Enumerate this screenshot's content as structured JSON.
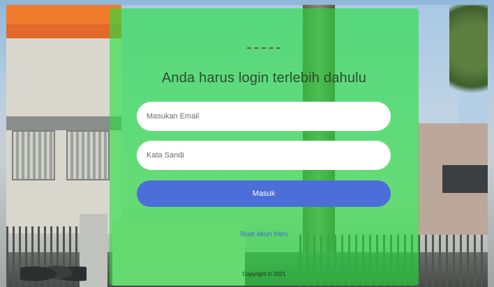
{
  "login": {
    "title": "Anda harus login terlebih dahulu",
    "email_placeholder": "Masukan Email",
    "password_placeholder": "Kata Sandi",
    "submit_label": "Masuk",
    "register_link": "Buat akun baru",
    "copyright": "Copyright © 2021"
  },
  "colors": {
    "card_overlay": "#23e13c",
    "button": "#4b6ed9",
    "link": "#3f6bd3"
  }
}
